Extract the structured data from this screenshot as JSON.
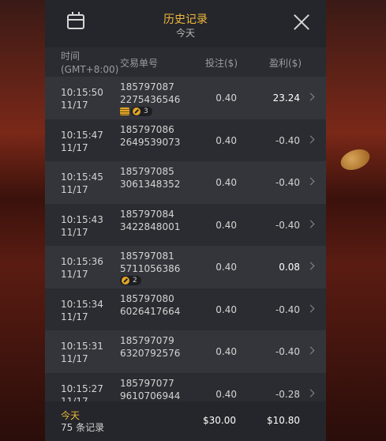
{
  "header": {
    "title": "历史记录",
    "subtitle": "今天",
    "calendar_icon": "calendar-icon",
    "close_icon": "close-icon"
  },
  "columns": {
    "time_line1": "时间",
    "time_line2": "(GMT+8:00)",
    "id": "交易单号",
    "bet": "投注($)",
    "profit": "盈利($)"
  },
  "rows": [
    {
      "time": "10:15:50",
      "date": "11/17",
      "id1": "185797087",
      "id2": "2275436546",
      "bet": "0.40",
      "profit": "23.24",
      "badge_count": "3",
      "stack": true
    },
    {
      "time": "10:15:47",
      "date": "11/17",
      "id1": "185797086",
      "id2": "2649539073",
      "bet": "0.40",
      "profit": "-0.40"
    },
    {
      "time": "10:15:45",
      "date": "11/17",
      "id1": "185797085",
      "id2": "3061348352",
      "bet": "0.40",
      "profit": "-0.40"
    },
    {
      "time": "10:15:43",
      "date": "11/17",
      "id1": "185797084",
      "id2": "3422848001",
      "bet": "0.40",
      "profit": "-0.40"
    },
    {
      "time": "10:15:36",
      "date": "11/17",
      "id1": "185797081",
      "id2": "5711056386",
      "bet": "0.40",
      "profit": "0.08",
      "badge_count": "2"
    },
    {
      "time": "10:15:34",
      "date": "11/17",
      "id1": "185797080",
      "id2": "6026417664",
      "bet": "0.40",
      "profit": "-0.40"
    },
    {
      "time": "10:15:31",
      "date": "11/17",
      "id1": "185797079",
      "id2": "6320792576",
      "bet": "0.40",
      "profit": "-0.40"
    },
    {
      "time": "10:15:27",
      "date": "11/17",
      "id1": "185797077",
      "id2": "9610706944",
      "bet": "0.40",
      "profit": "-0.28"
    }
  ],
  "footer": {
    "today": "今天",
    "count": "75 条记录",
    "total_bet": "$30.00",
    "total_profit": "$10.80"
  }
}
